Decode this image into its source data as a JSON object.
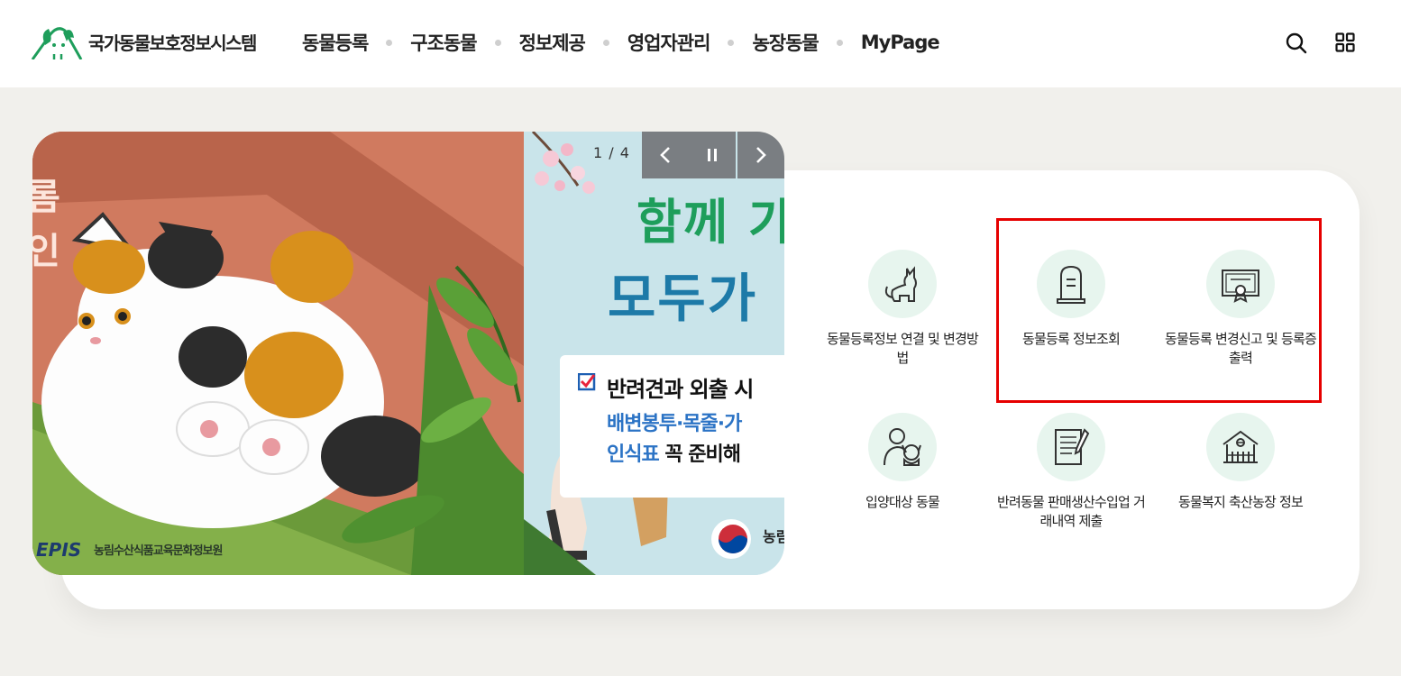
{
  "header": {
    "logo_text": "국가동물보호정보시스템",
    "nav": [
      "동물등록",
      "구조동물",
      "정보제공",
      "영업자관리",
      "농장동물",
      "MyPage"
    ],
    "icons": [
      "search-icon",
      "grid-menu-icon"
    ]
  },
  "banner": {
    "counter": "1 / 4",
    "slide_a_text": [
      "롬",
      "인"
    ],
    "epis_logo": "EPIS",
    "epis_org": "농림수산식품교육문화정보원",
    "slide_b_title1": "함께 가",
    "slide_b_title2": "모두가",
    "slide_b_note1": "반려견과 외출 시",
    "slide_b_note2": "배변봉투·목줄·가",
    "slide_b_note3_a": "인식표",
    "slide_b_note3_b": " 꼭 준비해",
    "ministry": "농림",
    "controls": [
      "chevron-left-icon",
      "pause-icon",
      "chevron-right-icon"
    ]
  },
  "services": [
    {
      "label": "동물등록정보 연결 및 변경방법",
      "icon": "cat-icon"
    },
    {
      "label": "동물등록 정보조회",
      "icon": "tombstone-icon"
    },
    {
      "label": "동물등록 변경신고 및 등록증출력",
      "icon": "certificate-icon"
    },
    {
      "label": "입양대상 동물",
      "icon": "person-with-dog-icon"
    },
    {
      "label": "반려동물 판매생산수입업 거래내역 제출",
      "icon": "document-pen-icon"
    },
    {
      "label": "동물복지 축산농장 정보",
      "icon": "barn-icon"
    }
  ],
  "colors": {
    "accent_green": "#1e9e5b",
    "service_circle": "#e7f5ee",
    "highlight_red": "#e60000",
    "page_bg": "#f1f0ec"
  }
}
